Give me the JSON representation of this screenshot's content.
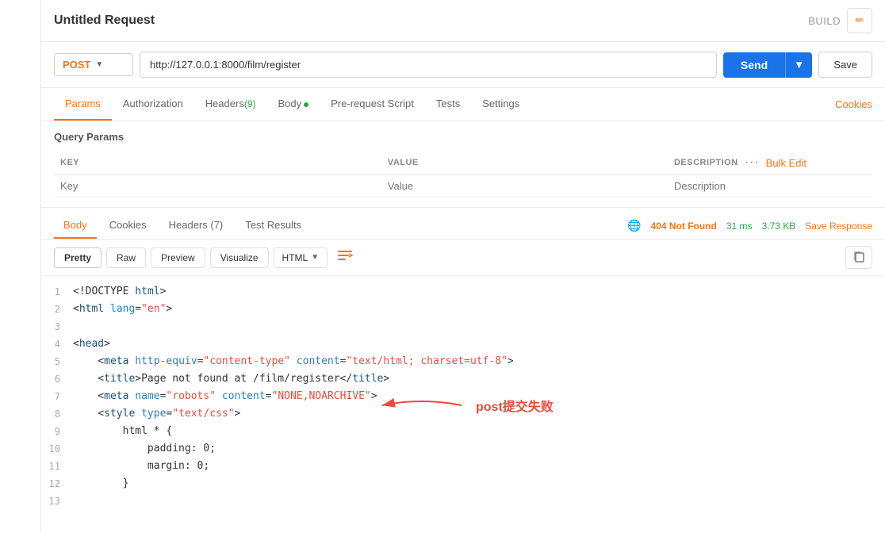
{
  "header": {
    "title": "Untitled Request",
    "build_label": "BUILD",
    "edit_icon": "✏"
  },
  "urlbar": {
    "method": "POST",
    "url": "http://127.0.0.1:8000/film/register",
    "send_label": "Send",
    "save_label": "Save"
  },
  "tabs": [
    {
      "id": "params",
      "label": "Params",
      "active": true
    },
    {
      "id": "authorization",
      "label": "Authorization",
      "active": false
    },
    {
      "id": "headers",
      "label": "Headers",
      "badge": "(9)",
      "active": false
    },
    {
      "id": "body",
      "label": "Body",
      "dot": true,
      "active": false
    },
    {
      "id": "pre-request",
      "label": "Pre-request Script",
      "active": false
    },
    {
      "id": "tests",
      "label": "Tests",
      "active": false
    },
    {
      "id": "settings",
      "label": "Settings",
      "active": false
    }
  ],
  "cookies_link": "Cookies",
  "query_params": {
    "title": "Query Params",
    "columns": [
      "KEY",
      "VALUE",
      "DESCRIPTION"
    ],
    "placeholder_key": "Key",
    "placeholder_value": "Value",
    "placeholder_desc": "Description"
  },
  "response": {
    "tabs": [
      {
        "id": "body",
        "label": "Body",
        "active": true
      },
      {
        "id": "cookies",
        "label": "Cookies",
        "active": false
      },
      {
        "id": "headers",
        "label": "Headers (7)",
        "active": false
      },
      {
        "id": "test-results",
        "label": "Test Results",
        "active": false
      }
    ],
    "status": "404 Not Found",
    "time": "31 ms",
    "size": "3.73 KB",
    "save_response": "Save Response",
    "globe_icon": "🌐"
  },
  "response_toolbar": {
    "formats": [
      "Pretty",
      "Raw",
      "Preview",
      "Visualize"
    ],
    "active_format": "Pretty",
    "language": "HTML",
    "word_wrap_icon": "≡→",
    "copy_icon": "⧉"
  },
  "code_lines": [
    {
      "num": 1,
      "html": "&lt;!DOCTYPE <span class=\"kw\">html</span>&gt;"
    },
    {
      "num": 2,
      "html": "&lt;<span class=\"tag\">html</span> <span class=\"attr-name\">lang</span>=<span class=\"attr-val\">\"en\"</span>&gt;"
    },
    {
      "num": 3,
      "html": ""
    },
    {
      "num": 4,
      "html": "&lt;<span class=\"tag\">head</span>&gt;"
    },
    {
      "num": 5,
      "html": "    &lt;<span class=\"tag\">meta</span> <span class=\"attr-name\">http-equiv</span>=<span class=\"attr-val\">\"content-type\"</span> <span class=\"attr-name\">content</span>=<span class=\"attr-val\">\"text/html; charset=utf-8\"</span>&gt;"
    },
    {
      "num": 6,
      "html": "    &lt;<span class=\"tag\">title</span>&gt;Page not found at /film/register&lt;/<span class=\"tag\">title</span>&gt;"
    },
    {
      "num": 7,
      "html": "    &lt;<span class=\"tag\">meta</span> <span class=\"attr-name\">name</span>=<span class=\"attr-val\">\"robots\"</span> <span class=\"attr-name\">content</span>=<span class=\"attr-val\">\"NONE,NOARCHIVE\"</span>&gt;"
    },
    {
      "num": 8,
      "html": "    &lt;<span class=\"tag\">style</span> <span class=\"attr-name\">type</span>=<span class=\"attr-val\">\"text/css\"</span>&gt;"
    },
    {
      "num": 9,
      "html": "        html * {"
    },
    {
      "num": 10,
      "html": "            padding: 0;"
    },
    {
      "num": 11,
      "html": "            margin: 0;"
    },
    {
      "num": 12,
      "html": "        }"
    },
    {
      "num": 13,
      "html": ""
    }
  ],
  "annotation": {
    "text": "post提交失败",
    "arrow": "→"
  }
}
